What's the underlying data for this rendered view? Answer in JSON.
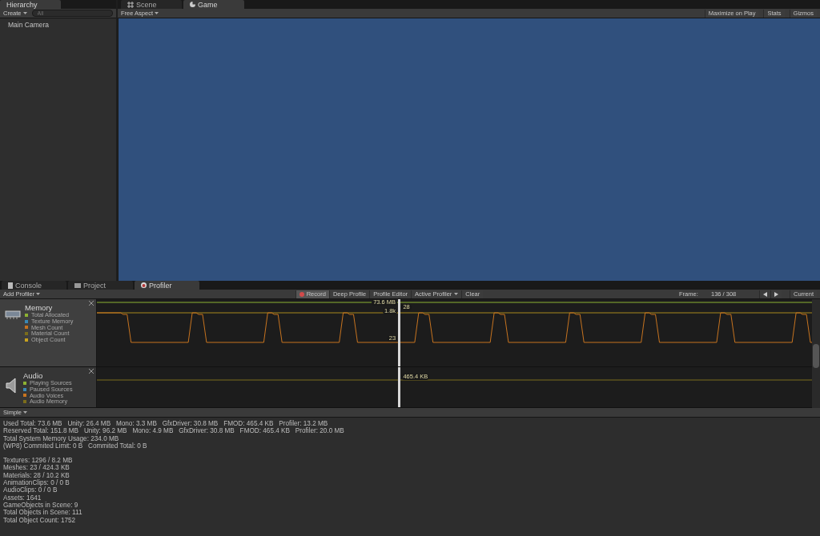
{
  "hierarchy": {
    "tab": "Hierarchy",
    "create": "Create",
    "search_placeholder": "All",
    "items": [
      {
        "label": "Main Camera",
        "selected": false
      }
    ]
  },
  "view_tabs": [
    {
      "label": "Scene",
      "kind": "scene",
      "selected": false
    },
    {
      "label": "Game",
      "kind": "game",
      "selected": true
    }
  ],
  "game_toolbar": {
    "aspect": "Free Aspect",
    "buttons": [
      {
        "label": "Maximize on Play",
        "on": false
      },
      {
        "label": "Stats",
        "on": false
      },
      {
        "label": "Gizmos",
        "on": false
      }
    ]
  },
  "bottom_tabs": [
    {
      "label": "Console",
      "kind": "console",
      "selected": false
    },
    {
      "label": "Project",
      "kind": "project",
      "selected": false
    },
    {
      "label": "Profiler",
      "kind": "profiler",
      "selected": true
    }
  ],
  "profiler_toolbar": {
    "add_profiler": "Add Profiler",
    "buttons": [
      {
        "label": "Record",
        "kind": "record",
        "on": true
      },
      {
        "label": "Deep Profile",
        "kind": "plain",
        "on": false
      },
      {
        "label": "Profile Editor",
        "kind": "plain",
        "on": false
      },
      {
        "label": "Active Profiler",
        "kind": "dropdown",
        "on": false
      },
      {
        "label": "Clear",
        "kind": "plain",
        "on": false
      }
    ],
    "frame_label": "Frame:",
    "frame_value": "136 / 308",
    "current": "Current"
  },
  "areas": [
    {
      "title": "Memory",
      "kind": "memory",
      "legend": [
        {
          "label": "Total Allocated",
          "color": "#8db232"
        },
        {
          "label": "Texture Memory",
          "color": "#3a88b5"
        },
        {
          "label": "Mesh Count",
          "color": "#c7731f"
        },
        {
          "label": "Material Count",
          "color": "#7b6d1c"
        },
        {
          "label": "Object Count",
          "color": "#c9a31f"
        }
      ],
      "readouts": [
        "73.6 MB",
        "1.8k",
        "28",
        "23"
      ]
    },
    {
      "title": "Audio",
      "kind": "audio",
      "legend": [
        {
          "label": "Playing Sources",
          "color": "#8db232"
        },
        {
          "label": "Paused Sources",
          "color": "#3a88b5"
        },
        {
          "label": "Audio Voices",
          "color": "#c7731f"
        },
        {
          "label": "Audio Memory",
          "color": "#7b6d1c"
        }
      ],
      "readouts": [
        "465.4 KB"
      ]
    }
  ],
  "detail_mode": "Simple",
  "stats": [
    [
      "Used Total: 73.6 MB   Unity: 26.4 MB   Mono: 3.3 MB   GfxDriver: 30.8 MB   FMOD: 465.4 KB   Profiler: 13.2 MB",
      "Reserved Total: 151.8 MB   Unity: 96.2 MB   Mono: 4.9 MB   GfxDriver: 30.8 MB   FMOD: 465.4 KB   Profiler: 20.0 MB",
      "Total System Memory Usage: 234.0 MB",
      "(WP8) Commited Limit: 0 B   Commited Total: 0 B"
    ],
    [
      "Textures: 1296 / 8.2 MB",
      "Meshes: 23 / 424.3 KB",
      "Materials: 28 / 10.2 KB",
      "AnimationClips: 0 / 0 B",
      "AudioClips: 0 / 0 B",
      "Assets: 1641",
      "GameObjects in Scene: 9",
      "Total Objects in Scene: 111",
      "Total Object Count: 1752"
    ]
  ]
}
